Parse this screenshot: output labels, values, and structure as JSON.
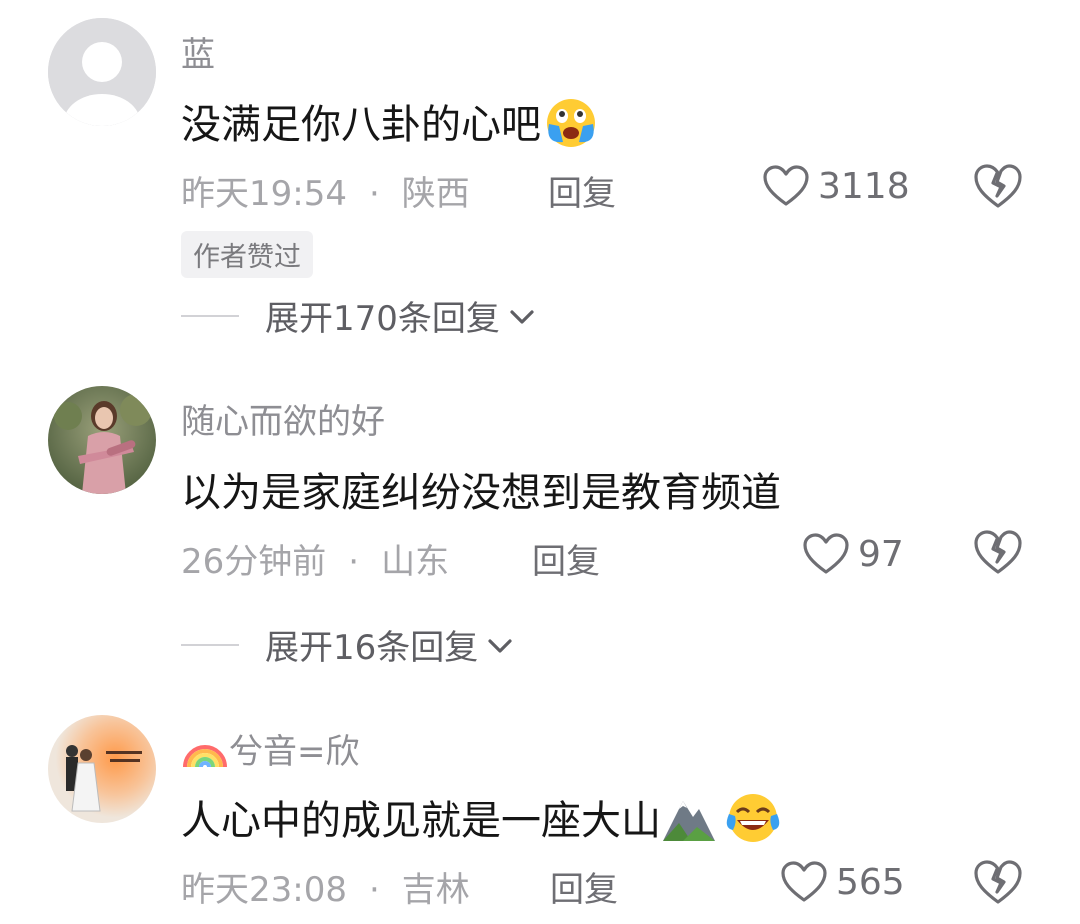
{
  "comments": [
    {
      "username": "蓝",
      "text": "没满足你八卦的心吧",
      "emoji": "loudly-crying-face-emoji",
      "time": "昨天19:54",
      "separator": "·",
      "location": "陕西",
      "reply_label": "回复",
      "likes": "3118",
      "badge": "作者赞过",
      "expand_label": "展开170条回复"
    },
    {
      "username": "随心而欲的好",
      "text": "以为是家庭纠纷没想到是教育频道",
      "time": "26分钟前",
      "separator": "·",
      "location": "山东",
      "reply_label": "回复",
      "likes": "97",
      "expand_label": "展开16条回复"
    },
    {
      "username_prefix_emoji": "rainbow-emoji",
      "username": "兮音=欣",
      "text": "人心中的成见就是一座大山",
      "emojis": [
        "mountain-emoji",
        "tears-of-joy-emoji"
      ],
      "time": "昨天23:08",
      "separator": "·",
      "location": "吉林",
      "reply_label": "回复",
      "likes": "565"
    }
  ],
  "icons": {
    "like": "heart-outline-icon",
    "dislike": "broken-heart-icon",
    "expand": "chevron-down-icon"
  },
  "colors": {
    "username": "#8e8e93",
    "content": "#161616",
    "meta": "#a5a5a9",
    "action": "#6e6e73"
  }
}
